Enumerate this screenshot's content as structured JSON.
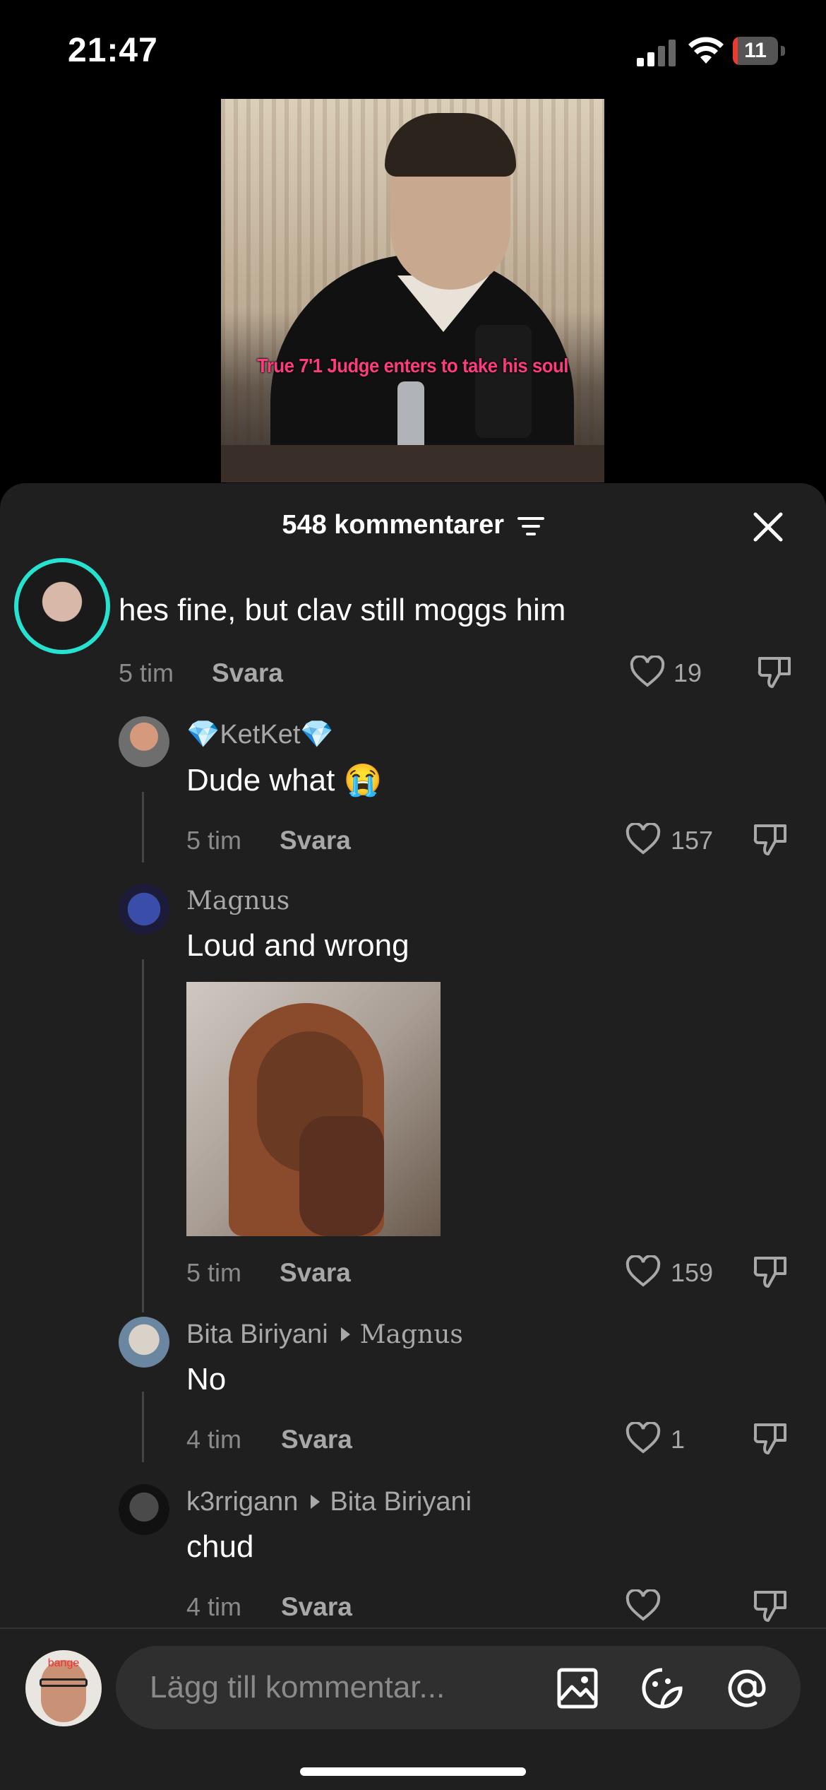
{
  "status": {
    "time": "21:47",
    "battery": "11",
    "battery_level": 0.11
  },
  "video": {
    "caption": "True 7'1 Judge enters to take his soul"
  },
  "sheet": {
    "title": "548 kommentarer"
  },
  "comments": [
    {
      "text": "hes fine, but clav still moggs him",
      "time": "5 tim",
      "reply": "Svara",
      "likes": "19"
    },
    {
      "name": "💎KetKet💎",
      "text": "Dude what 😭",
      "time": "5 tim",
      "reply": "Svara",
      "likes": "157"
    },
    {
      "name": "Magnus",
      "text": "Loud and wrong",
      "time": "5 tim",
      "reply": "Svara",
      "likes": "159"
    },
    {
      "name": "Bita Biriyani",
      "reply_to": "Magnus",
      "text": "No",
      "time": "4 tim",
      "reply": "Svara",
      "likes": "1"
    },
    {
      "name": "k3rrigann",
      "reply_to": "Bita Biriyani",
      "text": "chud",
      "time": "4 tim",
      "reply": "Svara"
    }
  ],
  "composer": {
    "placeholder": "Lägg till kommentar...",
    "avatar_label": "bange"
  },
  "icons": {
    "filter": "filter-icon",
    "close": "close-icon",
    "like": "heart-icon",
    "dislike": "thumbs-down-icon",
    "image": "image-icon",
    "sticker": "sticker-icon",
    "mention": "at-icon"
  }
}
